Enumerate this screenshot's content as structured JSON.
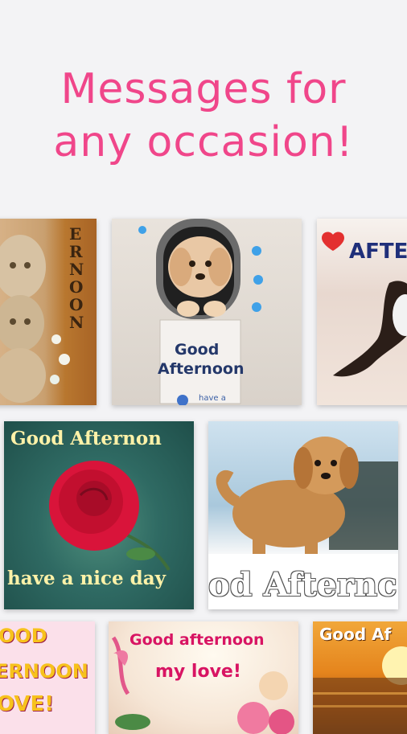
{
  "headline": {
    "line1": "Messages for",
    "line2": "any occasion!"
  },
  "cards": [
    {
      "id": "card-1",
      "text": "ERNOON"
    },
    {
      "id": "card-2",
      "line1": "Good",
      "line2": "Afternoon",
      "small": "have a"
    },
    {
      "id": "card-3",
      "text": "AFTE"
    },
    {
      "id": "card-4",
      "top": "Good Afternon",
      "bottom": "have a nice day"
    },
    {
      "id": "card-5",
      "text": "od Afternc"
    },
    {
      "id": "card-6",
      "line1": "OOD",
      "line2": "ERNOON",
      "line3": "OVE!"
    },
    {
      "id": "card-7",
      "line1": "Good afternoon",
      "line2": "my love!"
    },
    {
      "id": "card-8",
      "text": "Good Af"
    }
  ],
  "colors": {
    "headline": "#f0468a",
    "background": "#f3f3f5"
  }
}
